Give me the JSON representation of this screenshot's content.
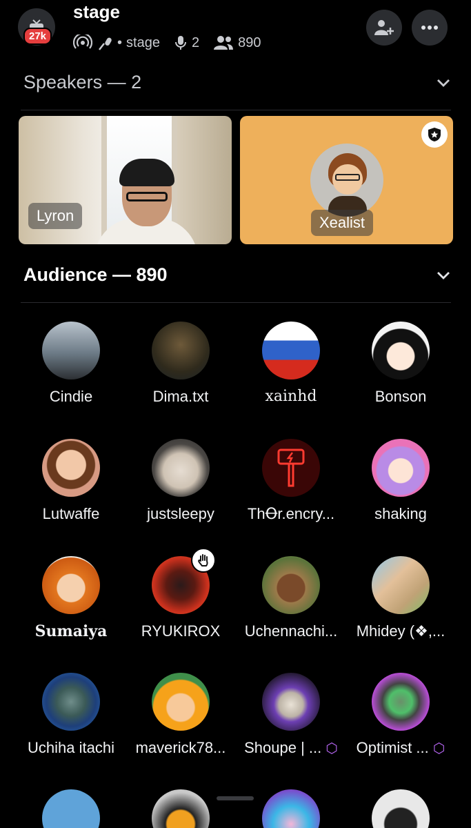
{
  "header": {
    "title": "stage",
    "badge": "27k",
    "channel_type": "stage",
    "speaker_count": "2",
    "listener_count": "890"
  },
  "speakers": {
    "section_label": "Speakers — 2",
    "tiles": [
      {
        "name": "Lyron"
      },
      {
        "name": "Xealist"
      }
    ]
  },
  "audience": {
    "section_label": "Audience — 890",
    "members": [
      {
        "name": "Cindie",
        "color": "#4a5f70"
      },
      {
        "name": "Dima.txt",
        "color": "#3d3a2c"
      },
      {
        "name": "xainhd",
        "color": "#2f62c9"
      },
      {
        "name": "Bonson",
        "color": "#f3f3f3"
      },
      {
        "name": "Lutwaffe",
        "color": "#c98a6a"
      },
      {
        "name": "justsleepy",
        "color": "#5b5651"
      },
      {
        "name": "ThꝊr.encry...",
        "color": "#3a0606"
      },
      {
        "name": "shaking",
        "color": "#ea72b8"
      },
      {
        "name": "Sumaiya",
        "color": "#cc7a3d"
      },
      {
        "name": "RYUKIROX",
        "color": "#b3261c"
      },
      {
        "name": "Uchennachi...",
        "color": "#59733a"
      },
      {
        "name": "Mhidey (❖,...",
        "color": "#c0a276"
      },
      {
        "name": "Uchiha itachi",
        "color": "#2b6fbd"
      },
      {
        "name": "maverick78...",
        "color": "#3f8f4a"
      },
      {
        "name": "Shoupe | ...",
        "color": "#21182e"
      },
      {
        "name": "Optimist ...",
        "color": "#b84dd6"
      },
      {
        "name": "",
        "color": "#5fa3d9"
      },
      {
        "name": "",
        "color": "#c9c9c9"
      },
      {
        "name": "",
        "color": "#7a4ccc"
      },
      {
        "name": "",
        "color": "#e8e8e8"
      }
    ]
  }
}
